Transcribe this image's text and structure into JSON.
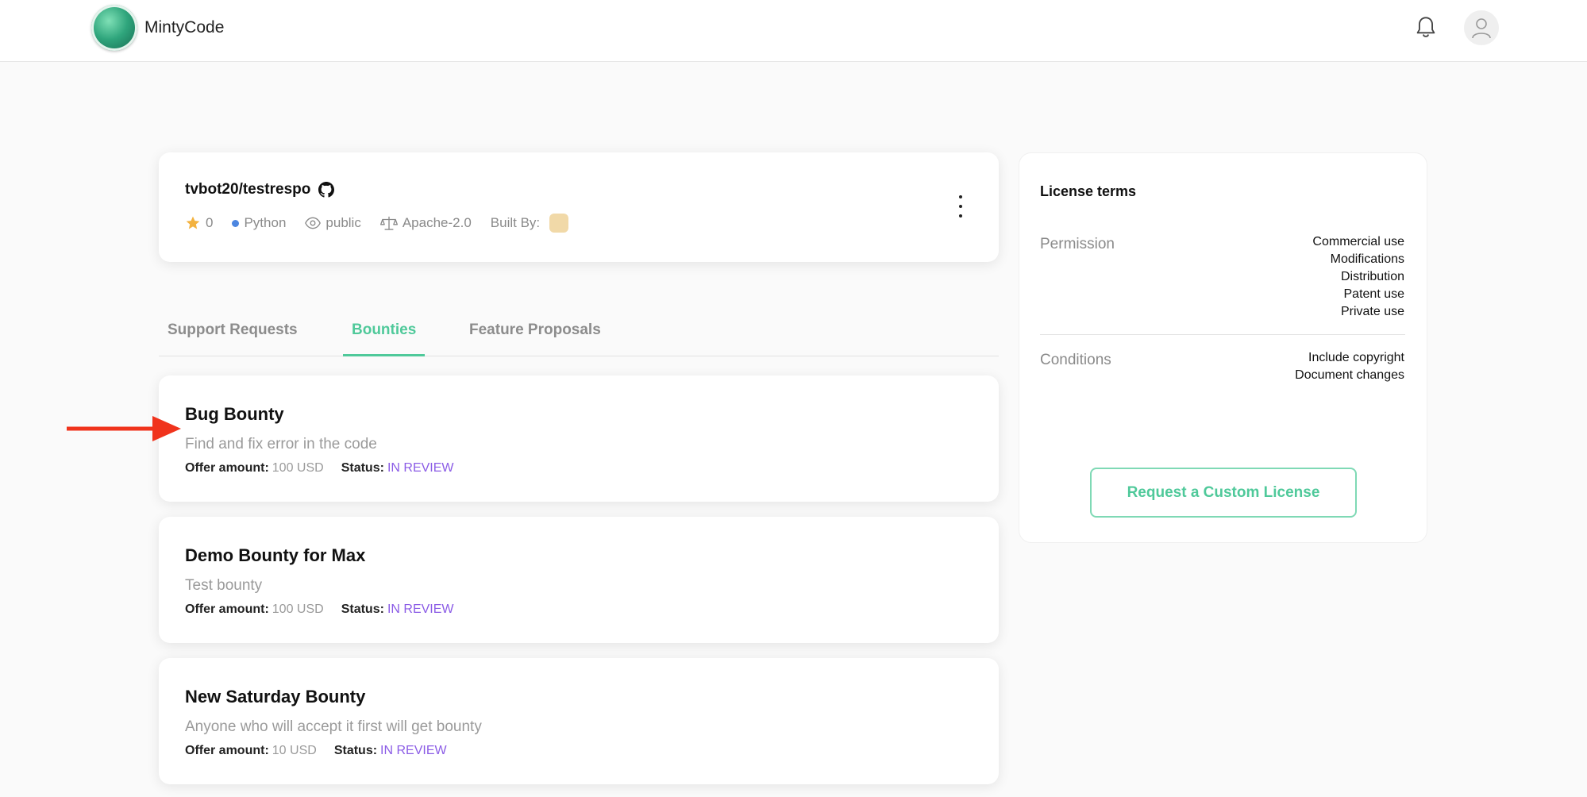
{
  "header": {
    "brand": "MintyCode"
  },
  "repo": {
    "name": "tvbot20/testrespo",
    "stars": "0",
    "language": "Python",
    "visibility": "public",
    "license": "Apache-2.0",
    "built_by_label": "Built By:"
  },
  "tabs": [
    {
      "label": "Support Requests",
      "active": false
    },
    {
      "label": "Bounties",
      "active": true
    },
    {
      "label": "Feature Proposals",
      "active": false
    }
  ],
  "bounties": [
    {
      "title": "Bug Bounty",
      "description": "Find and fix error in the code",
      "offer_label": "Offer amount:",
      "offer_value": "100 USD",
      "status_label": "Status:",
      "status_value": "IN REVIEW"
    },
    {
      "title": "Demo Bounty for Max",
      "description": "Test bounty",
      "offer_label": "Offer amount:",
      "offer_value": "100 USD",
      "status_label": "Status:",
      "status_value": "IN REVIEW"
    },
    {
      "title": "New Saturday Bounty",
      "description": "Anyone who will accept it first will get bounty",
      "offer_label": "Offer amount:",
      "offer_value": "10 USD",
      "status_label": "Status:",
      "status_value": "IN REVIEW"
    }
  ],
  "license_terms": {
    "title": "License terms",
    "permission_label": "Permission",
    "permissions": [
      "Commercial use",
      "Modifications",
      "Distribution",
      "Patent use",
      "Private use"
    ],
    "conditions_label": "Conditions",
    "conditions": [
      "Include copyright",
      "Document changes"
    ],
    "button_label": "Request a Custom License"
  },
  "colors": {
    "accent": "#4fc99a",
    "status": "#8b5ce6",
    "language_dot": "#4c86e0",
    "star": "#f3b23f",
    "annotation_arrow": "#f0331c"
  },
  "icons": [
    "logo-icon",
    "bell-icon",
    "user-icon",
    "github-icon",
    "star-icon",
    "eye-icon",
    "scale-icon",
    "kebab-menu-icon",
    "arrow-annotation-icon"
  ]
}
